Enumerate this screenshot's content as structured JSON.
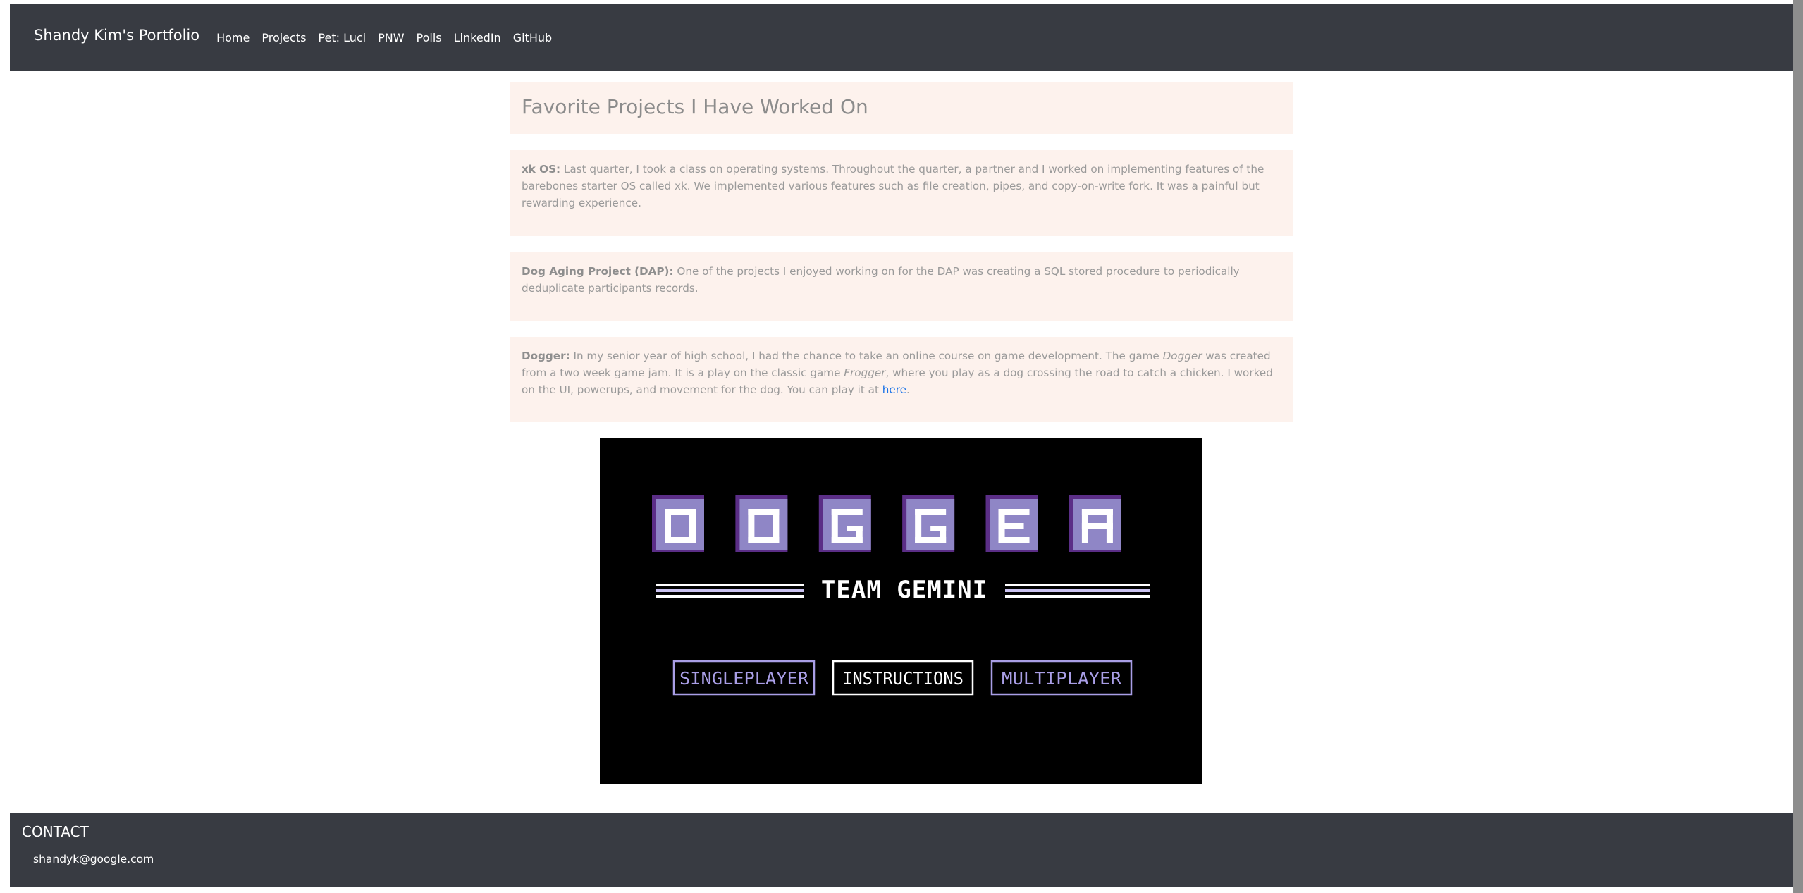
{
  "navbar": {
    "brand": "Shandy Kim's Portfolio",
    "links": [
      "Home",
      "Projects",
      "Pet: Luci",
      "PNW",
      "Polls",
      "LinkedIn",
      "GitHub"
    ]
  },
  "main": {
    "title": "Favorite Projects I Have Worked On",
    "projects": [
      {
        "name": "xk OS:",
        "text": " Last quarter, I took a class on operating systems. Throughout the quarter, a partner and I worked on implementing features of the barebones starter OS called xk. We implemented various features such as file creation, pipes, and copy-on-write fork. It was a painful but rewarding experience."
      },
      {
        "name": "Dog Aging Project (DAP):",
        "text": " One of the projects I enjoyed working on for the DAP was creating a SQL stored procedure to periodically deduplicate participants records."
      },
      {
        "name": "Dogger:",
        "text_1": " In my senior year of high school, I had the chance to take an online course on game development. The game ",
        "italic_1": "Dogger",
        "text_2": " was created from a two week game jam. It is a play on the classic game ",
        "italic_2": "Frogger",
        "text_3": ", where you play as a dog crossing the road to catch a chicken. I worked on the UI, powerups, and movement for the dog. You can play it at ",
        "link": "here",
        "text_4": "."
      }
    ]
  },
  "game_image": {
    "logo_letters": [
      "D",
      "O",
      "G",
      "G",
      "E",
      "R"
    ],
    "subtitle": "TEAM GEMINI",
    "buttons": [
      "SINGLEPLAYER",
      "INSTRUCTIONS",
      "MULTIPLAYER"
    ],
    "colors": {
      "background": "#000000",
      "logo_fill": "#8f86c6",
      "logo_shadow": "#5b2e87",
      "purple_text": "#a99ee6",
      "white": "#ffffff"
    }
  },
  "footer": {
    "heading": "CONTACT",
    "email": "shandyk@google.com"
  },
  "colors": {
    "navbar_bg": "#383b42",
    "card_bg": "#fdf2ed",
    "link": "#1a73e8"
  }
}
